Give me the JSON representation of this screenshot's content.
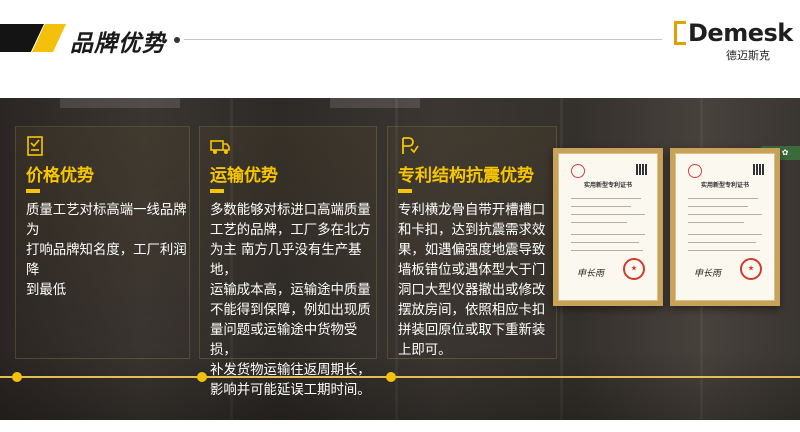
{
  "header": {
    "title": "品牌优势",
    "logo_text": "Demesk",
    "logo_sub": "德迈斯克"
  },
  "badge": {
    "label": "中 ◦ ✿"
  },
  "cards": [
    {
      "icon": "tag-icon",
      "heading": "价格优势",
      "lines": [
        "质量工艺对标高端一线品牌为",
        "打响品牌知名度，工厂利润降",
        "到最低"
      ]
    },
    {
      "icon": "truck-icon",
      "heading": "运输优势",
      "lines": [
        "多数能够对标进口高端质量",
        "工艺的品牌，工厂多在北方",
        "为主 南方几乎没有生产基地，",
        "运输成本高，运输途中质量",
        "不能得到保障，例如出现质",
        "量问题或运输途中货物受损，",
        "补发货物运输往返周期长，",
        "影响并可能延误工期时间。"
      ]
    },
    {
      "icon": "patent-icon",
      "heading": "专利结构抗震优势",
      "lines": [
        "专利横龙骨自带开槽槽口",
        "和卡扣，达到抗震需求效",
        "果，如遇偏强度地震导致",
        "墙板错位或遇体型大于门",
        "洞口大型仪器撤出或修改",
        "摆放房间，依照相应卡扣",
        "拼装回原位或取下重新装",
        "上即可。"
      ]
    }
  ],
  "certificates": [
    {
      "title": "实用新型专利证书",
      "signature": "申长雨"
    },
    {
      "title": "实用新型专利证书",
      "signature": "申长雨"
    }
  ],
  "colors": {
    "accent": "#f3c10b",
    "heading": "#f7c600",
    "dark": "#141414"
  }
}
